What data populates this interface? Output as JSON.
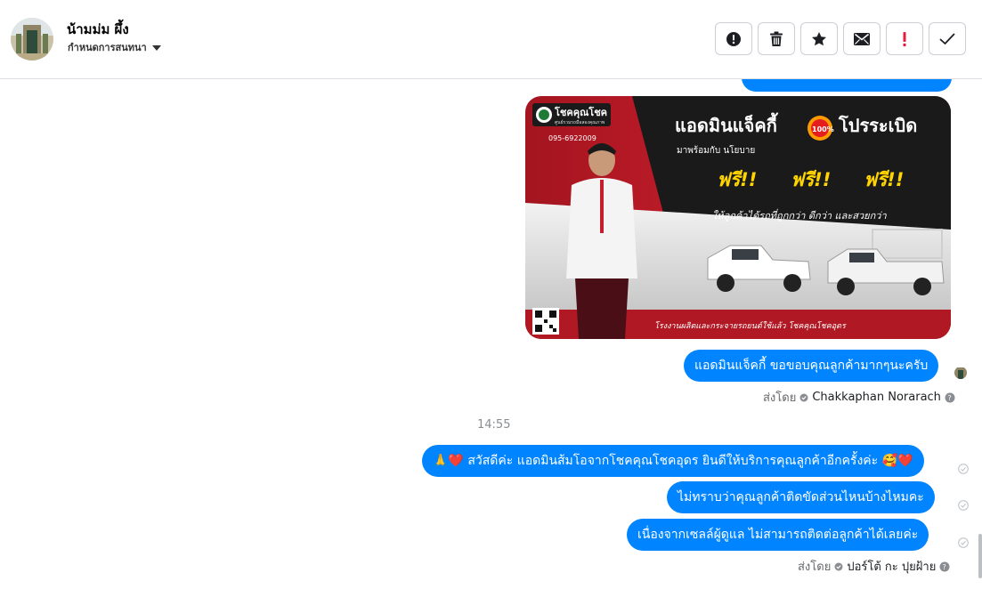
{
  "header": {
    "contact_name": "น้ามม่ม ผึ้ง",
    "assign_label": "กำหนดการสนทนา",
    "avatar_icon": "profile-photo",
    "toolbar": [
      {
        "name": "spam-button",
        "icon": "alert-circle-icon"
      },
      {
        "name": "delete-button",
        "icon": "trash-icon"
      },
      {
        "name": "star-button",
        "icon": "star-icon"
      },
      {
        "name": "mark-unread-button",
        "icon": "envelope-icon"
      },
      {
        "name": "follow-up-button",
        "icon": "exclamation-icon"
      },
      {
        "name": "done-button",
        "icon": "checkmark-icon"
      }
    ]
  },
  "thread": {
    "image_banner": {
      "brand": "โชคคุณโชค",
      "brand_sub": "ศูนย์รวมรถมือสองคุณภาพ",
      "phone": "095-6922009",
      "headline": "แอดมินแจ็คกี้",
      "badge": "100%",
      "headline_tail": "โปรระเบิด",
      "subline": "มาพร้อมกับ นโยบาย",
      "free": "ฟรี!!",
      "tagline": "ให้ลูกค้าได้รถที่ถูกกว่า ดีกว่า และสวยกว่า",
      "footer": "โรงงานผลิตและกระจายรถยนต์ใช้แล้ว โชคคุณโชคอุดร"
    },
    "msg_thanks": "แอดมินแจ็คกี้ ขอขอบคุณลูกค้ามากๆนะครับ",
    "sent_by_1_label": "ส่งโดย",
    "sent_by_1_agent": "Chakkaphan Norarach",
    "time_divider": "14:55",
    "msg_greeting": "🙏❤️ สวัสดีค่ะ แอดมินส้มโอจากโชคคุณโชคอุดร ยินดีให้บริการคุณลูกค้าอีกครั้งค่ะ 🥰❤️",
    "msg_question": "ไม่ทราบว่าคุณลูกค้าติดขัดส่วนไหนบ้างไหมคะ",
    "msg_reason": "เนื่องจากเซลล์ผู้ดูแล ไม่สามารถติดต่อลูกค้าได้เลยค่ะ",
    "sent_by_2_label": "ส่งโดย",
    "sent_by_2_agent": "ปอร์โต้ กะ ปุยฝ้าย"
  },
  "colors": {
    "bubble": "#0084ff",
    "banner_red": "#b71c2b",
    "banner_dark": "#1a1a1a",
    "free_yellow": "#ffd400"
  }
}
